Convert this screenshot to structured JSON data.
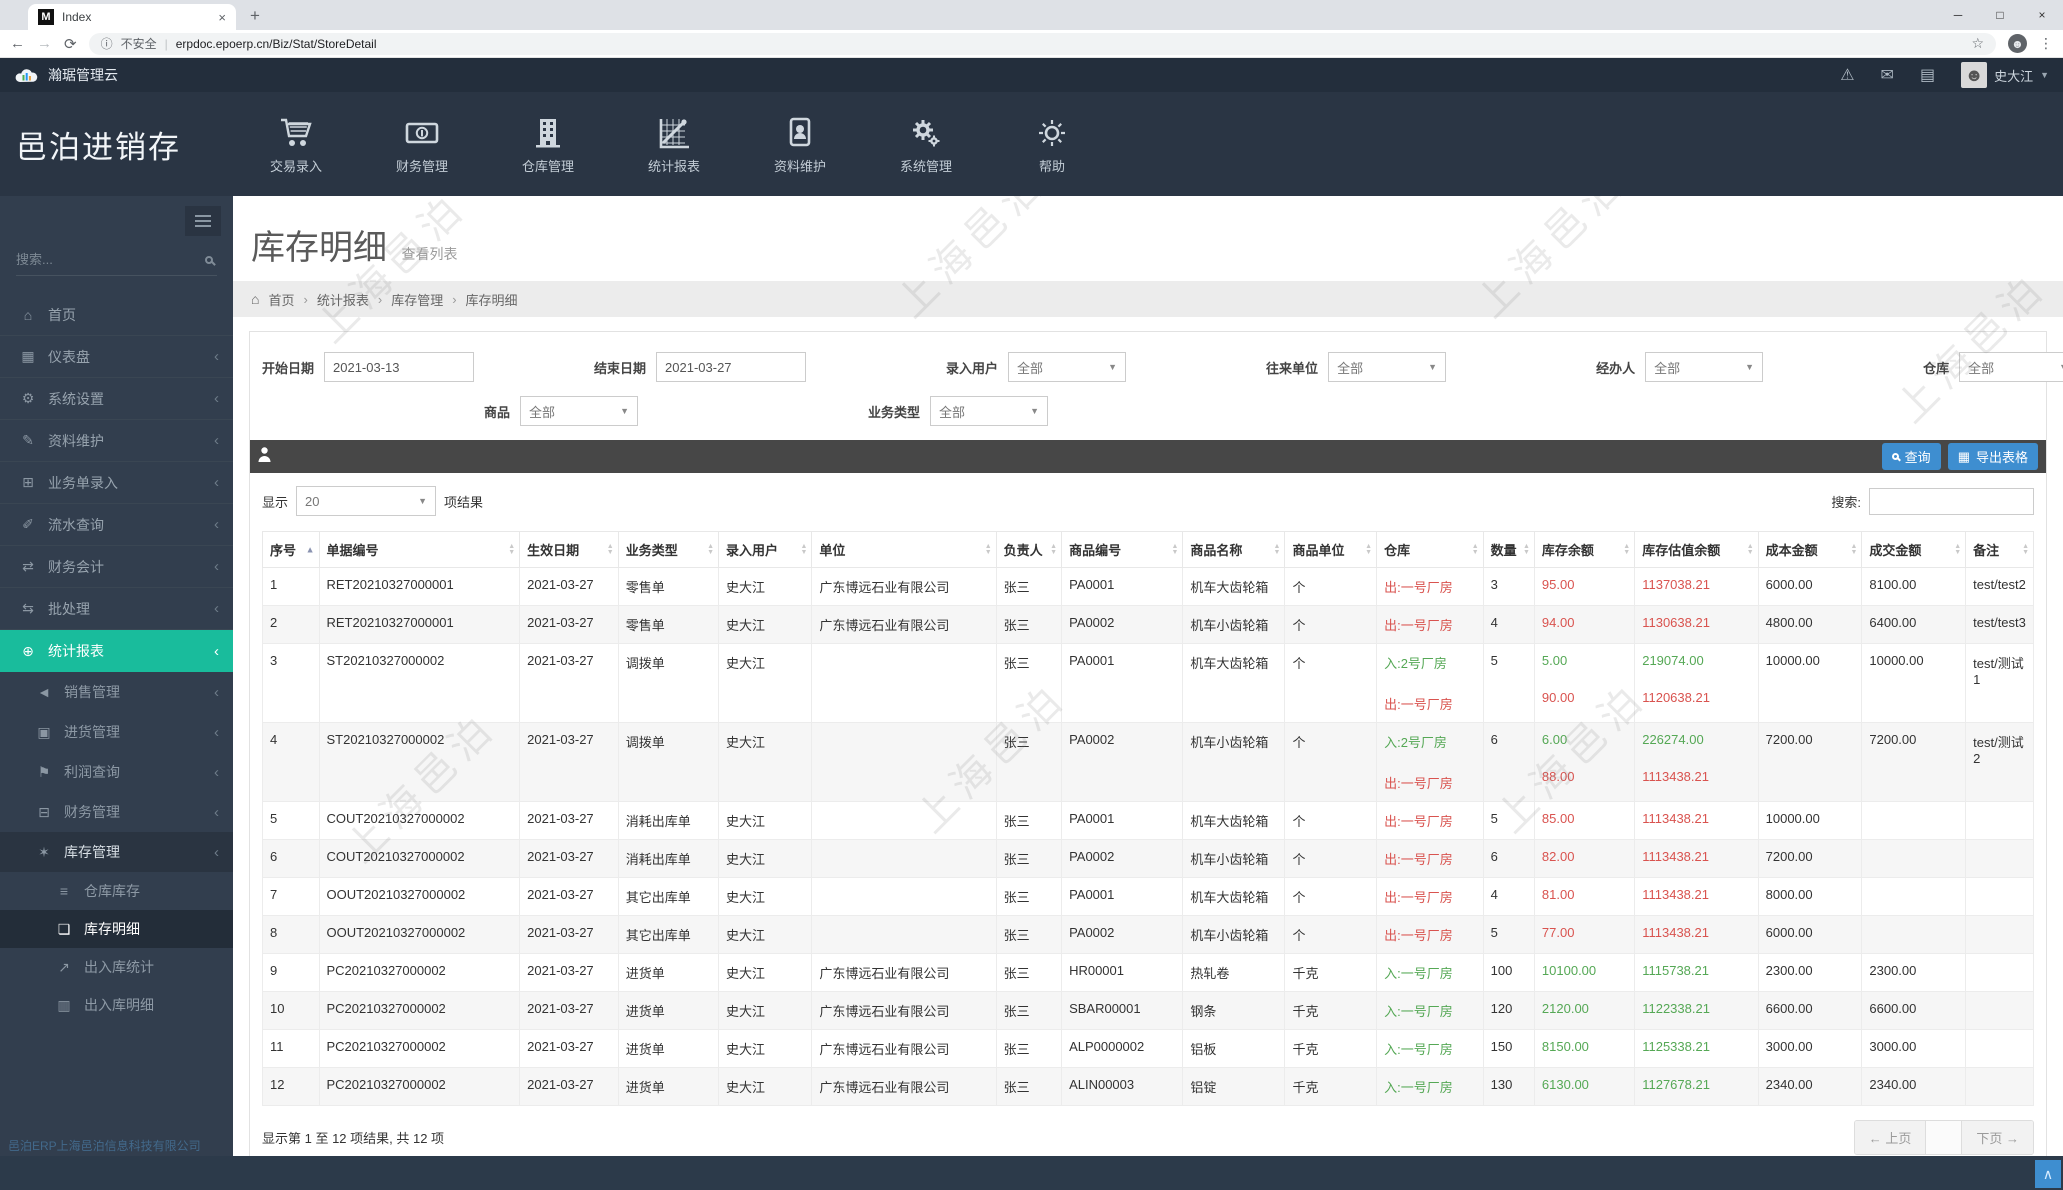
{
  "browser": {
    "tab_title": "Index",
    "favicon_letter": "M",
    "security_label": "不安全",
    "url": "erpdoc.epoerp.cn/Biz/Stat/StoreDetail"
  },
  "header": {
    "cloud_title": "瀚琚管理云",
    "brand": "邑泊进销存",
    "user_name": "史大江",
    "menu": [
      {
        "label": "交易录入",
        "icon": "cart-icon"
      },
      {
        "label": "财务管理",
        "icon": "money-icon"
      },
      {
        "label": "仓库管理",
        "icon": "warehouse-icon"
      },
      {
        "label": "统计报表",
        "icon": "report-icon"
      },
      {
        "label": "资料维护",
        "icon": "idcard-icon"
      },
      {
        "label": "系统管理",
        "icon": "gears-icon"
      },
      {
        "label": "帮助",
        "icon": "help-icon"
      }
    ]
  },
  "sidebar": {
    "search_placeholder": "搜索...",
    "items": [
      {
        "name": "home",
        "label": "首页",
        "icon": "home-icon"
      },
      {
        "name": "dashboard",
        "label": "仪表盘",
        "icon": "dashboard-icon",
        "chevron": true
      },
      {
        "name": "system-settings",
        "label": "系统设置",
        "icon": "settings-icon",
        "chevron": true
      },
      {
        "name": "data-maintenance",
        "label": "资料维护",
        "icon": "data-icon",
        "chevron": true
      },
      {
        "name": "order-entry",
        "label": "业务单录入",
        "icon": "order-entry-icon",
        "chevron": true
      },
      {
        "name": "flow-query",
        "label": "流水查询",
        "icon": "flow-query-icon",
        "chevron": true
      },
      {
        "name": "accounting",
        "label": "财务会计",
        "icon": "accounting-icon",
        "chevron": true
      },
      {
        "name": "batch",
        "label": "批处理",
        "icon": "batch-icon",
        "chevron": true
      },
      {
        "name": "reports",
        "label": "统计报表",
        "icon": "report-globe-icon",
        "chevron": true,
        "active": true,
        "children": [
          {
            "name": "sales-mgmt",
            "label": "销售管理",
            "icon": "sales-icon",
            "chevron": true
          },
          {
            "name": "purchase-mgmt",
            "label": "进货管理",
            "icon": "purchase-icon",
            "chevron": true
          },
          {
            "name": "profit-query",
            "label": "利润查询",
            "icon": "profit-icon",
            "chevron": true
          },
          {
            "name": "finance-mgmt",
            "label": "财务管理",
            "icon": "finance-icon",
            "chevron": true
          },
          {
            "name": "inventory-mgmt",
            "label": "库存管理",
            "icon": "inventory-icon",
            "chevron": true,
            "expanded": true,
            "children": [
              {
                "name": "warehouse-stock",
                "label": "仓库库存",
                "icon": "warehouse-stock-icon"
              },
              {
                "name": "stock-detail",
                "label": "库存明细",
                "icon": "stock-detail-icon",
                "current": true
              },
              {
                "name": "inout-stats",
                "label": "出入库统计",
                "icon": "inout-stats-icon"
              },
              {
                "name": "inout-detail",
                "label": "出入库明细",
                "icon": "inout-detail-icon"
              }
            ]
          }
        ]
      }
    ]
  },
  "page": {
    "title": "库存明细",
    "subtitle": "查看列表",
    "breadcrumb": [
      "首页",
      "统计报表",
      "库存管理",
      "库存明细"
    ]
  },
  "filters": {
    "start_date": {
      "label": "开始日期",
      "value": "2021-03-13"
    },
    "end_date": {
      "label": "结束日期",
      "value": "2021-03-27"
    },
    "entry_user": {
      "label": "录入用户",
      "value": "全部"
    },
    "company": {
      "label": "往来单位",
      "value": "全部"
    },
    "manager": {
      "label": "经办人",
      "value": "全部"
    },
    "warehouse": {
      "label": "仓库",
      "value": "全部"
    },
    "product": {
      "label": "商品",
      "value": "全部"
    },
    "biz_type": {
      "label": "业务类型",
      "value": "全部"
    }
  },
  "toolbar": {
    "query_label": "查询",
    "export_label": "导出表格"
  },
  "list_controls": {
    "show_label": "显示",
    "page_size": "20",
    "results_label": "项结果",
    "search_label": "搜索:"
  },
  "table": {
    "columns": [
      {
        "key": "seq",
        "label": "序号",
        "sort": "asc"
      },
      {
        "key": "doc_no",
        "label": "单据编号",
        "sort": "both"
      },
      {
        "key": "date",
        "label": "生效日期",
        "sort": "both"
      },
      {
        "key": "biz_type",
        "label": "业务类型",
        "sort": "both"
      },
      {
        "key": "entry_user",
        "label": "录入用户",
        "sort": "both"
      },
      {
        "key": "company",
        "label": "单位",
        "sort": "both"
      },
      {
        "key": "manager",
        "label": "负责人",
        "sort": "both"
      },
      {
        "key": "product_code",
        "label": "商品编号",
        "sort": "both"
      },
      {
        "key": "product_name",
        "label": "商品名称",
        "sort": "both"
      },
      {
        "key": "unit",
        "label": "商品单位",
        "sort": "both"
      },
      {
        "key": "warehouse",
        "label": "仓库",
        "sort": "both"
      },
      {
        "key": "qty",
        "label": "数量",
        "sort": "both"
      },
      {
        "key": "stock_balance",
        "label": "库存余额",
        "sort": "both"
      },
      {
        "key": "value_balance",
        "label": "库存估值余额",
        "sort": "both"
      },
      {
        "key": "cost",
        "label": "成本金额",
        "sort": "both"
      },
      {
        "key": "deal",
        "label": "成交金额",
        "sort": "both"
      },
      {
        "key": "remark",
        "label": "备注",
        "sort": "both"
      }
    ],
    "rows": [
      {
        "seq": "1",
        "doc_no": "RET20210327000001",
        "date": "2021-03-27",
        "biz_type": "零售单",
        "entry_user": "史大江",
        "company": "广东博远石业有限公司",
        "manager": "张三",
        "product_code": "PA0001",
        "product_name": "机车大齿轮箱",
        "unit": "个",
        "warehouse": [
          {
            "text": "出:一号厂房",
            "dir": "out"
          }
        ],
        "qty": "3",
        "stock_balance": [
          {
            "text": "95.00",
            "dir": "out"
          }
        ],
        "value_balance": [
          {
            "text": "1137038.21",
            "dir": "out"
          }
        ],
        "cost": "6000.00",
        "deal": "8100.00",
        "remark": "test/test2"
      },
      {
        "seq": "2",
        "doc_no": "RET20210327000001",
        "date": "2021-03-27",
        "biz_type": "零售单",
        "entry_user": "史大江",
        "company": "广东博远石业有限公司",
        "manager": "张三",
        "product_code": "PA0002",
        "product_name": "机车小齿轮箱",
        "unit": "个",
        "warehouse": [
          {
            "text": "出:一号厂房",
            "dir": "out"
          }
        ],
        "qty": "4",
        "stock_balance": [
          {
            "text": "94.00",
            "dir": "out"
          }
        ],
        "value_balance": [
          {
            "text": "1130638.21",
            "dir": "out"
          }
        ],
        "cost": "4800.00",
        "deal": "6400.00",
        "remark": "test/test3"
      },
      {
        "seq": "3",
        "doc_no": "ST20210327000002",
        "date": "2021-03-27",
        "biz_type": "调拨单",
        "entry_user": "史大江",
        "company": "",
        "manager": "张三",
        "product_code": "PA0001",
        "product_name": "机车大齿轮箱",
        "unit": "个",
        "warehouse": [
          {
            "text": "入:2号厂房",
            "dir": "in"
          },
          {
            "text": "出:一号厂房",
            "dir": "out"
          }
        ],
        "qty": "5",
        "stock_balance": [
          {
            "text": "5.00",
            "dir": "in"
          },
          {
            "text": "90.00",
            "dir": "out"
          }
        ],
        "value_balance": [
          {
            "text": "219074.00",
            "dir": "in"
          },
          {
            "text": "1120638.21",
            "dir": "out"
          }
        ],
        "cost": "10000.00",
        "deal": "10000.00",
        "remark": "test/测试1"
      },
      {
        "seq": "4",
        "doc_no": "ST20210327000002",
        "date": "2021-03-27",
        "biz_type": "调拨单",
        "entry_user": "史大江",
        "company": "",
        "manager": "张三",
        "product_code": "PA0002",
        "product_name": "机车小齿轮箱",
        "unit": "个",
        "warehouse": [
          {
            "text": "入:2号厂房",
            "dir": "in"
          },
          {
            "text": "出:一号厂房",
            "dir": "out"
          }
        ],
        "qty": "6",
        "stock_balance": [
          {
            "text": "6.00",
            "dir": "in"
          },
          {
            "text": "88.00",
            "dir": "out"
          }
        ],
        "value_balance": [
          {
            "text": "226274.00",
            "dir": "in"
          },
          {
            "text": "1113438.21",
            "dir": "out"
          }
        ],
        "cost": "7200.00",
        "deal": "7200.00",
        "remark": "test/测试2"
      },
      {
        "seq": "5",
        "doc_no": "COUT20210327000002",
        "date": "2021-03-27",
        "biz_type": "消耗出库单",
        "entry_user": "史大江",
        "company": "",
        "manager": "张三",
        "product_code": "PA0001",
        "product_name": "机车大齿轮箱",
        "unit": "个",
        "warehouse": [
          {
            "text": "出:一号厂房",
            "dir": "out"
          }
        ],
        "qty": "5",
        "stock_balance": [
          {
            "text": "85.00",
            "dir": "out"
          }
        ],
        "value_balance": [
          {
            "text": "1113438.21",
            "dir": "out"
          }
        ],
        "cost": "10000.00",
        "deal": "",
        "remark": ""
      },
      {
        "seq": "6",
        "doc_no": "COUT20210327000002",
        "date": "2021-03-27",
        "biz_type": "消耗出库单",
        "entry_user": "史大江",
        "company": "",
        "manager": "张三",
        "product_code": "PA0002",
        "product_name": "机车小齿轮箱",
        "unit": "个",
        "warehouse": [
          {
            "text": "出:一号厂房",
            "dir": "out"
          }
        ],
        "qty": "6",
        "stock_balance": [
          {
            "text": "82.00",
            "dir": "out"
          }
        ],
        "value_balance": [
          {
            "text": "1113438.21",
            "dir": "out"
          }
        ],
        "cost": "7200.00",
        "deal": "",
        "remark": ""
      },
      {
        "seq": "7",
        "doc_no": "OOUT20210327000002",
        "date": "2021-03-27",
        "biz_type": "其它出库单",
        "entry_user": "史大江",
        "company": "",
        "manager": "张三",
        "product_code": "PA0001",
        "product_name": "机车大齿轮箱",
        "unit": "个",
        "warehouse": [
          {
            "text": "出:一号厂房",
            "dir": "out"
          }
        ],
        "qty": "4",
        "stock_balance": [
          {
            "text": "81.00",
            "dir": "out"
          }
        ],
        "value_balance": [
          {
            "text": "1113438.21",
            "dir": "out"
          }
        ],
        "cost": "8000.00",
        "deal": "",
        "remark": ""
      },
      {
        "seq": "8",
        "doc_no": "OOUT20210327000002",
        "date": "2021-03-27",
        "biz_type": "其它出库单",
        "entry_user": "史大江",
        "company": "",
        "manager": "张三",
        "product_code": "PA0002",
        "product_name": "机车小齿轮箱",
        "unit": "个",
        "warehouse": [
          {
            "text": "出:一号厂房",
            "dir": "out"
          }
        ],
        "qty": "5",
        "stock_balance": [
          {
            "text": "77.00",
            "dir": "out"
          }
        ],
        "value_balance": [
          {
            "text": "1113438.21",
            "dir": "out"
          }
        ],
        "cost": "6000.00",
        "deal": "",
        "remark": ""
      },
      {
        "seq": "9",
        "doc_no": "PC20210327000002",
        "date": "2021-03-27",
        "biz_type": "进货单",
        "entry_user": "史大江",
        "company": "广东博远石业有限公司",
        "manager": "张三",
        "product_code": "HR00001",
        "product_name": "热轧卷",
        "unit": "千克",
        "warehouse": [
          {
            "text": "入:一号厂房",
            "dir": "in"
          }
        ],
        "qty": "100",
        "stock_balance": [
          {
            "text": "10100.00",
            "dir": "in"
          }
        ],
        "value_balance": [
          {
            "text": "1115738.21",
            "dir": "in"
          }
        ],
        "cost": "2300.00",
        "deal": "2300.00",
        "remark": ""
      },
      {
        "seq": "10",
        "doc_no": "PC20210327000002",
        "date": "2021-03-27",
        "biz_type": "进货单",
        "entry_user": "史大江",
        "company": "广东博远石业有限公司",
        "manager": "张三",
        "product_code": "SBAR00001",
        "product_name": "钢条",
        "unit": "千克",
        "warehouse": [
          {
            "text": "入:一号厂房",
            "dir": "in"
          }
        ],
        "qty": "120",
        "stock_balance": [
          {
            "text": "2120.00",
            "dir": "in"
          }
        ],
        "value_balance": [
          {
            "text": "1122338.21",
            "dir": "in"
          }
        ],
        "cost": "6600.00",
        "deal": "6600.00",
        "remark": ""
      },
      {
        "seq": "11",
        "doc_no": "PC20210327000002",
        "date": "2021-03-27",
        "biz_type": "进货单",
        "entry_user": "史大江",
        "company": "广东博远石业有限公司",
        "manager": "张三",
        "product_code": "ALP0000002",
        "product_name": "铝板",
        "unit": "千克",
        "warehouse": [
          {
            "text": "入:一号厂房",
            "dir": "in"
          }
        ],
        "qty": "150",
        "stock_balance": [
          {
            "text": "8150.00",
            "dir": "in"
          }
        ],
        "value_balance": [
          {
            "text": "1125338.21",
            "dir": "in"
          }
        ],
        "cost": "3000.00",
        "deal": "3000.00",
        "remark": ""
      },
      {
        "seq": "12",
        "doc_no": "PC20210327000002",
        "date": "2021-03-27",
        "biz_type": "进货单",
        "entry_user": "史大江",
        "company": "广东博远石业有限公司",
        "manager": "张三",
        "product_code": "ALIN00003",
        "product_name": "铝锭",
        "unit": "千克",
        "warehouse": [
          {
            "text": "入:一号厂房",
            "dir": "in"
          }
        ],
        "qty": "130",
        "stock_balance": [
          {
            "text": "6130.00",
            "dir": "in"
          }
        ],
        "value_balance": [
          {
            "text": "1127678.21",
            "dir": "in"
          }
        ],
        "cost": "2340.00",
        "deal": "2340.00",
        "remark": ""
      }
    ]
  },
  "table_footer": {
    "info": "显示第 1 至 12 项结果, 共 12 项",
    "prev_label": "← 上页",
    "next_label": "下页 →"
  },
  "watermark": {
    "text": "上海邑泊"
  },
  "page_footer": {
    "company": "邑泊ERP上海邑泊信息科技有限公司"
  },
  "colors": {
    "accent_teal": "#19bc9c",
    "button_blue": "#3e8ed0",
    "in_green": "#55a855",
    "out_red": "#d9534f"
  }
}
